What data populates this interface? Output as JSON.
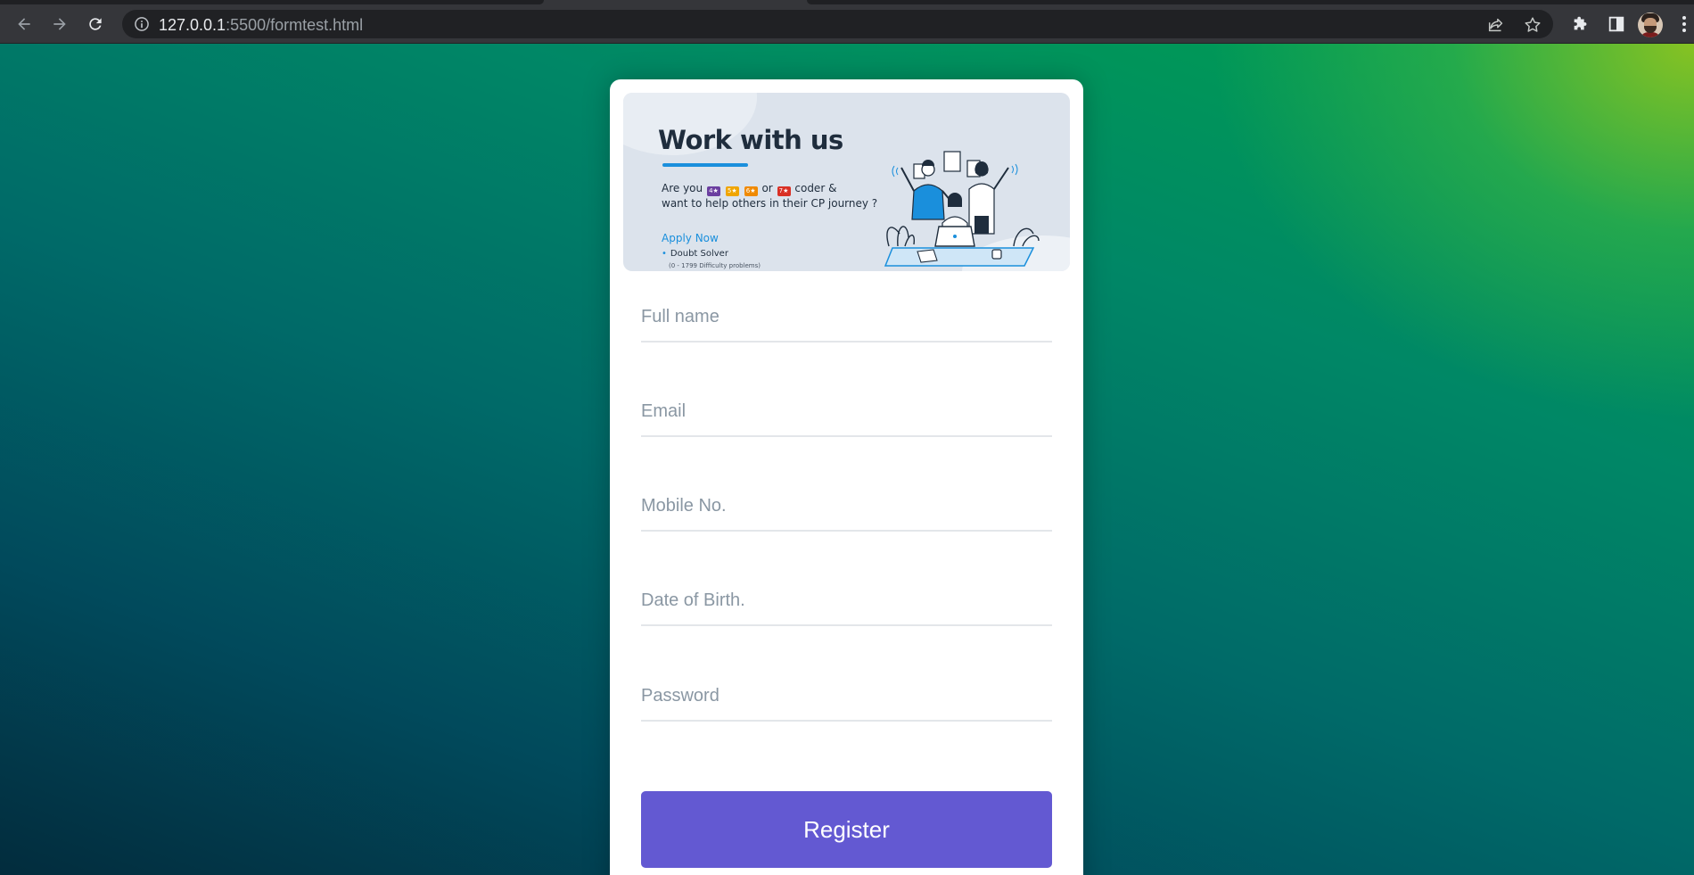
{
  "browser": {
    "url_host": "127.0.0.1",
    "url_rest": ":5500/formtest.html"
  },
  "banner": {
    "title": "Work with us",
    "line1_prefix": "Are you",
    "line1_or": "or",
    "line1_suffix": "coder &",
    "line2": "want to help others in their CP journey ?",
    "badges": [
      {
        "stars": "4★",
        "color": "#6b3fa0"
      },
      {
        "stars": "5★",
        "color": "#f0a500"
      },
      {
        "stars": "6★",
        "color": "#f08a00"
      },
      {
        "stars": "7★",
        "color": "#d93025"
      }
    ],
    "apply_label": "Apply Now",
    "bullet": "Doubt Solver",
    "bullet_sub": "(0 - 1799 Difficulty problems)"
  },
  "form": {
    "full_name_placeholder": "Full name",
    "email_placeholder": "Email",
    "mobile_placeholder": "Mobile No.",
    "dob_placeholder": "Date of Birth.",
    "password_placeholder": "Password",
    "register_label": "Register"
  }
}
